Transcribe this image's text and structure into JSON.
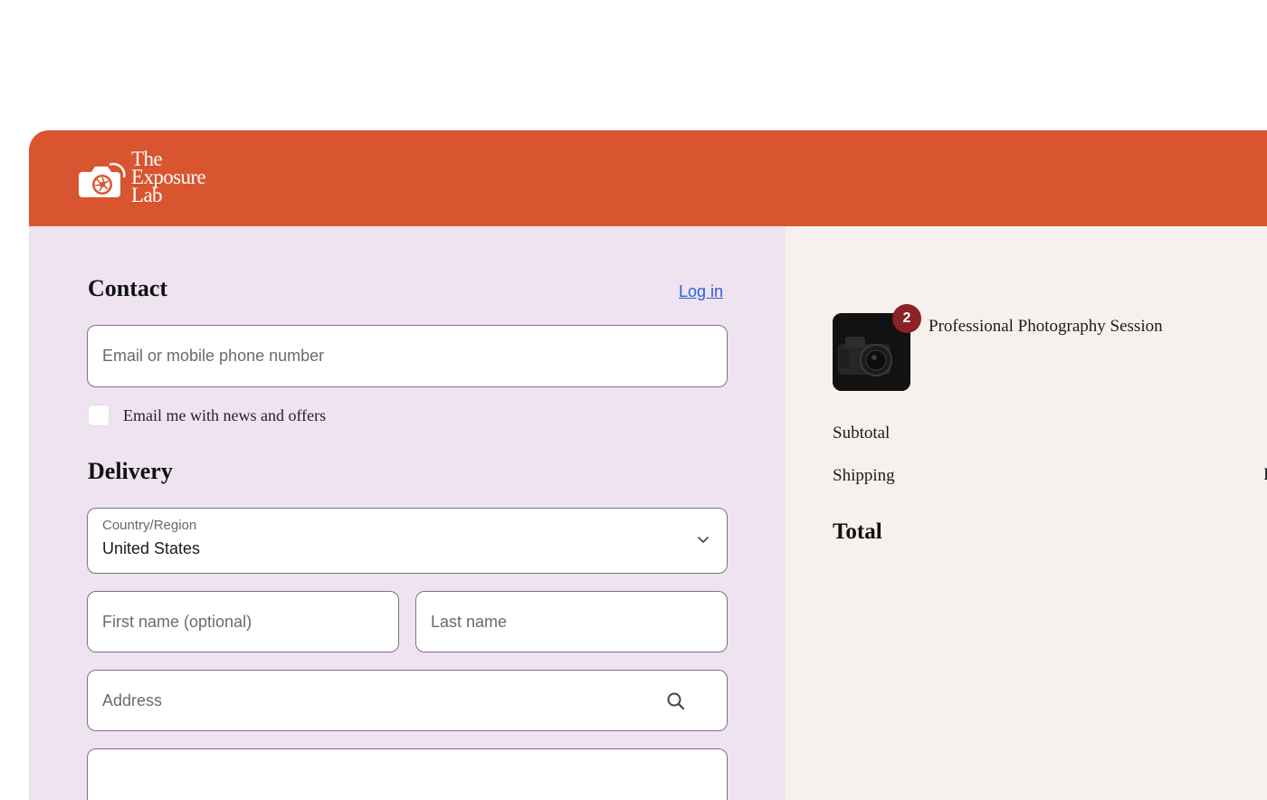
{
  "brand": {
    "name_line1": "The",
    "name_line2": "Exposure",
    "name_line3": "Lab",
    "header_color": "#d9552f",
    "logo_icon": "camera-aperture-icon"
  },
  "contact": {
    "heading": "Contact",
    "login_link": "Log in",
    "email_placeholder": "Email or mobile phone number",
    "newsletter_label": "Email me with news and offers",
    "newsletter_checked": false
  },
  "delivery": {
    "heading": "Delivery",
    "country_label": "Country/Region",
    "country_value": "United States",
    "first_name_placeholder": "First name (optional)",
    "last_name_placeholder": "Last name",
    "address_placeholder": "Address"
  },
  "summary": {
    "product_name": "Professional Photography Session",
    "quantity_badge": "2",
    "subtotal_label": "Subtotal",
    "shipping_label": "Shipping",
    "shipping_value_partial": "E",
    "total_label": "Total"
  },
  "colors": {
    "left_panel": "#efe3f1",
    "right_panel": "#f6f1ec",
    "link": "#2a62d6",
    "badge": "#8a2226"
  }
}
